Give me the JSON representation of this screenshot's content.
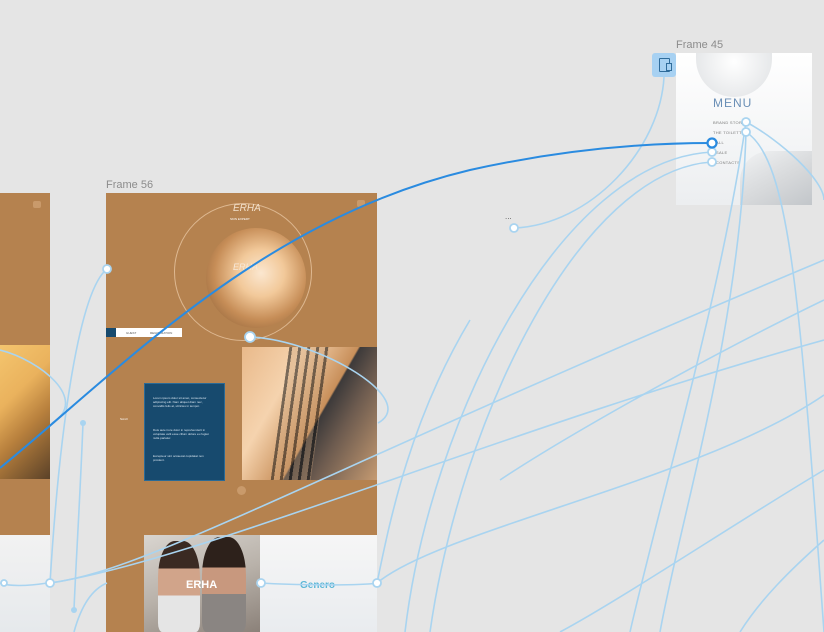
{
  "frames": {
    "frame45": {
      "label": "Frame 45"
    },
    "frame56": {
      "label": "Frame 56"
    }
  },
  "menu": {
    "title": "MENU",
    "items": [
      "BRAND STORY",
      "THE TOILETTE",
      "ALL",
      "SALE",
      "CONTACTS"
    ]
  },
  "frame56": {
    "logo_text": "ERHA",
    "logo_sub": "SKIN EXPERT",
    "badge_left": "GUEST",
    "badge_right": "REGISTRATION",
    "panel_text_1": "Lorem ipsum dolor sit amet, consectetur adipiscing elit. Nam aliquet diam nec, convallis felis at, ultricies in tempor.",
    "panel_text_2": "Duis aute irure dolor in reprehenderit in voluptate velit esse cillum dolore eu fugiat nulla pariatur.",
    "panel_text_3": "Excepteur sint occaecat cupidatat non proident.",
    "side_text": "Scroll",
    "card_erha": "ERHA",
    "card_genero": "Genero"
  },
  "ellipsis": "...",
  "colors": {
    "canvas": "#e5e5e5",
    "frame_tan": "#b5824f",
    "panel_navy": "#174a6e",
    "wire_light": "#a9d4f0",
    "wire_active": "#2a8be0",
    "device_icon_bg": "#a7d1f2"
  },
  "icons": {
    "device": "mobile-device-icon",
    "connection": "connection-node-icon"
  }
}
